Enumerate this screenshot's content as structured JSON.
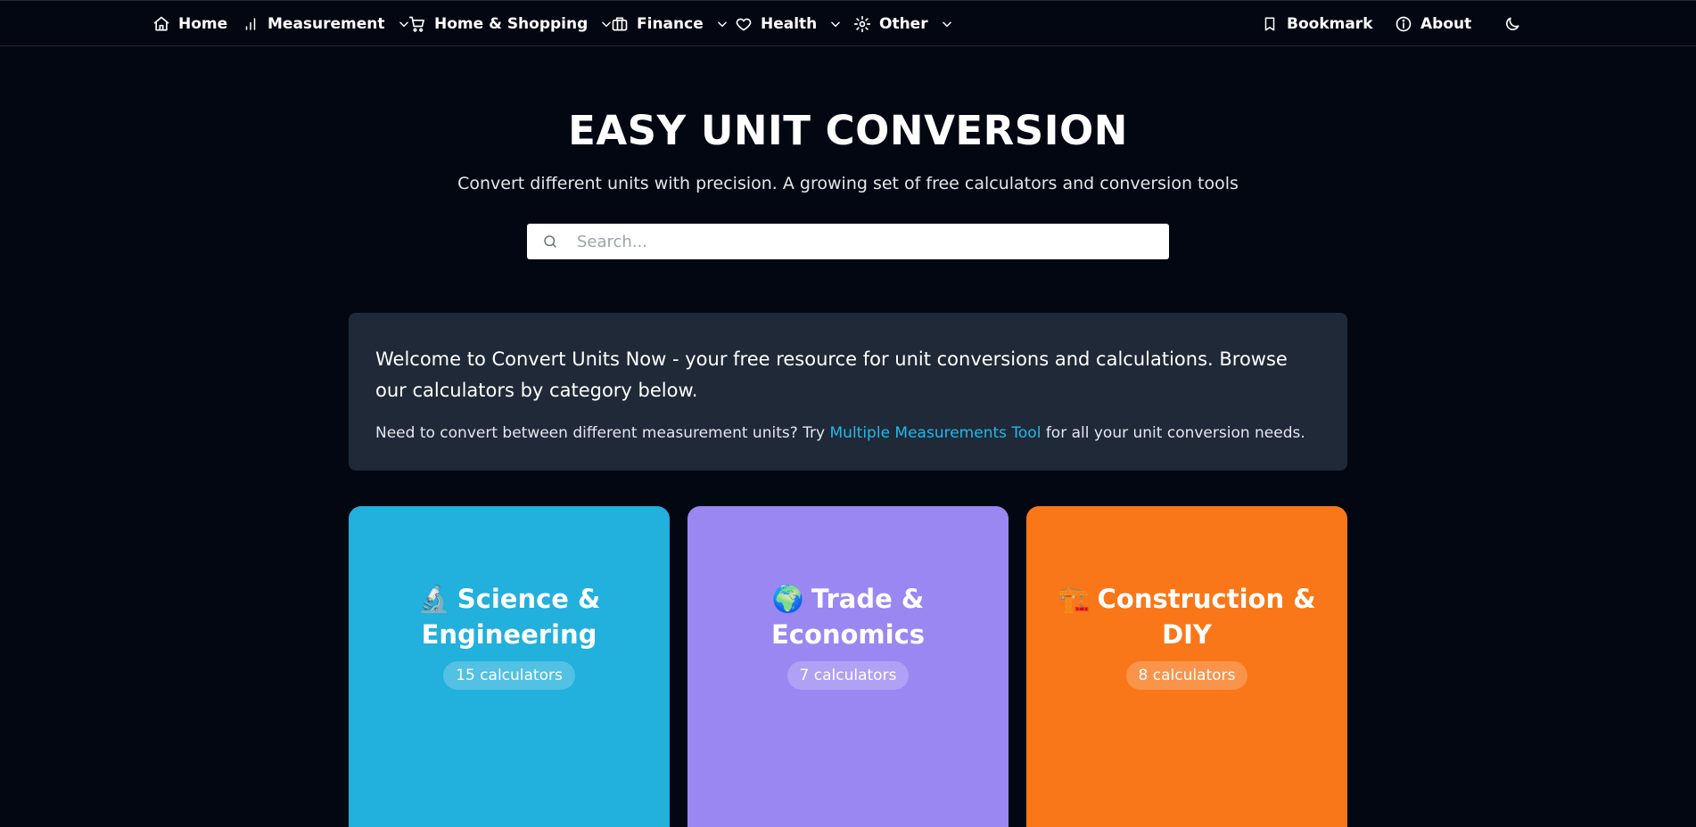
{
  "nav": {
    "home": "Home",
    "measurement": "Measurement",
    "home_shopping": "Home & Shopping",
    "finance": "Finance",
    "health": "Health",
    "other": "Other",
    "bookmark": "Bookmark",
    "about": "About"
  },
  "hero": {
    "title": "EASY UNIT CONVERSION",
    "subtitle": "Convert different units with precision. A growing set of free calculators and conversion tools"
  },
  "search": {
    "placeholder": "Search...",
    "value": ""
  },
  "welcome": {
    "text": "Welcome to Convert Units Now - your free resource for unit conversions and calculations. Browse our calculators by category below.",
    "note_before": "Need to convert between different measurement units? Try ",
    "link": "Multiple Measurements Tool",
    "note_after": " for all your unit conversion needs."
  },
  "categories": [
    {
      "emoji": "🔬",
      "title": "Science & Engineering",
      "count": "15 calculators",
      "color": "#22b0dc"
    },
    {
      "emoji": "🌍",
      "title": "Trade & Economics",
      "count": "7 calculators",
      "color": "#9b87f2"
    },
    {
      "emoji": "🏗️",
      "title": "Construction & DIY",
      "count": "8 calculators",
      "color": "#f97719"
    }
  ],
  "icons": {
    "home": "home-icon",
    "measurement": "bar-chart-icon",
    "home_shopping": "cart-icon",
    "finance": "briefcase-icon",
    "health": "heart-icon",
    "other": "gear-icon",
    "bookmark": "bookmark-icon",
    "about": "info-icon",
    "theme": "moon-icon",
    "search": "search-icon"
  },
  "colors": {
    "background": "#030712",
    "panel": "#1f2937",
    "link": "#22b8e8"
  }
}
